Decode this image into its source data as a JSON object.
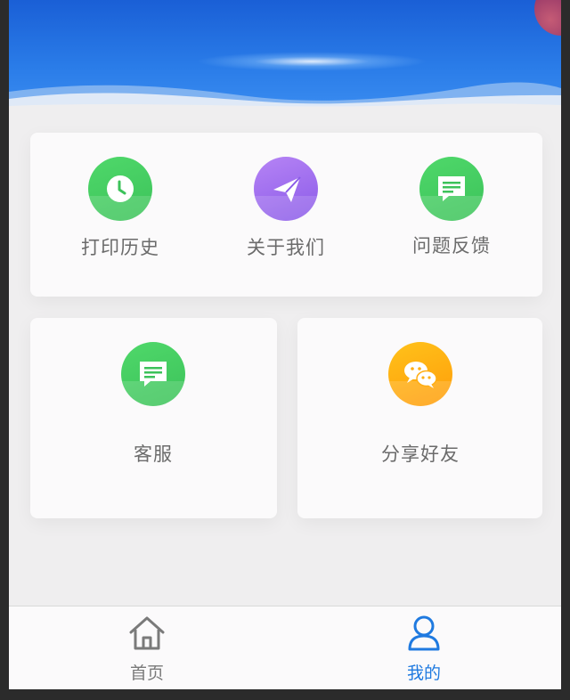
{
  "menu": {
    "print_history": {
      "label": "打印历史",
      "icon": "clock-icon",
      "color": "#3cc25a"
    },
    "about_us": {
      "label": "关于我们",
      "icon": "paper-plane-icon",
      "color": "#8a5ae8"
    },
    "feedback": {
      "label": "问题反馈",
      "icon": "message-icon",
      "color": "#3cc25a"
    },
    "customer_service": {
      "label": "客服",
      "icon": "message-icon",
      "color": "#3cc25a"
    },
    "share": {
      "label": "分享好友",
      "icon": "wechat-icon",
      "color": "#ffa510"
    }
  },
  "tabbar": {
    "home": {
      "label": "首页",
      "icon": "home-icon",
      "active": false
    },
    "mine": {
      "label": "我的",
      "icon": "user-icon",
      "active": true
    }
  },
  "colors": {
    "accent": "#1f7ae0",
    "inactive": "#7a7a7a",
    "banner": "#2a7ce8"
  }
}
